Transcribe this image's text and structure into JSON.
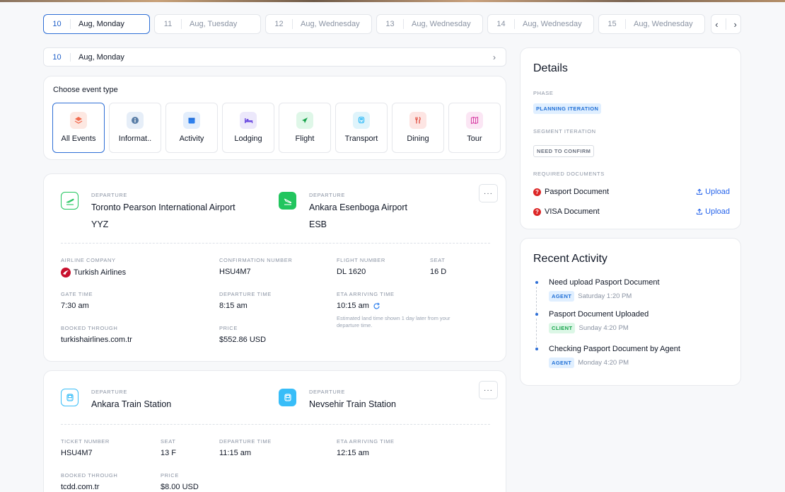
{
  "dates": [
    {
      "num": "10",
      "label": "Aug, Monday"
    },
    {
      "num": "11",
      "label": "Aug, Tuesday"
    },
    {
      "num": "12",
      "label": "Aug, Wednesday"
    },
    {
      "num": "13",
      "label": "Aug, Wednesday"
    },
    {
      "num": "14",
      "label": "Aug, Wednesday"
    },
    {
      "num": "15",
      "label": "Aug, Wednesday"
    }
  ],
  "nav": {
    "prev": "‹",
    "next": "›"
  },
  "selected_day": {
    "num": "10",
    "label": "Aug, Monday",
    "chevron": "›"
  },
  "event_type": {
    "title": "Choose event type",
    "types": [
      {
        "label": "All Events",
        "icon": "layers-icon"
      },
      {
        "label": "Informat..",
        "icon": "info-icon"
      },
      {
        "label": "Activity",
        "icon": "calendar-icon"
      },
      {
        "label": "Lodging",
        "icon": "bed-icon"
      },
      {
        "label": "Flight",
        "icon": "plane-icon"
      },
      {
        "label": "Transport",
        "icon": "train-icon"
      },
      {
        "label": "Dining",
        "icon": "fork-knife-icon"
      },
      {
        "label": "Tour",
        "icon": "map-icon"
      }
    ]
  },
  "flight": {
    "from": {
      "caption": "DEPARTURE",
      "name": "Toronto Pearson International Airport",
      "code": "YYZ"
    },
    "to": {
      "caption": "DEPARTURE",
      "name": "Ankara Esenboga Airport",
      "code": "ESB"
    },
    "more": "···",
    "airline": {
      "caption": "AIRLINE COMPANY",
      "value": "Turkish Airlines"
    },
    "confirmation": {
      "caption": "CONFIRMATION NUMBER",
      "value": "HSU4M7"
    },
    "flight_number": {
      "caption": "FLIGHT NUMBER",
      "value": "DL 1620"
    },
    "seat": {
      "caption": "SEAT",
      "value": "16 D"
    },
    "gate_time": {
      "caption": "GATE TIME",
      "value": "7:30 am"
    },
    "departure_time": {
      "caption": "DEPARTURE TIME",
      "value": "8:15 am"
    },
    "eta": {
      "caption": "ETA ARRIVING TIME",
      "value": "10:15 am",
      "note": "Estimated land time shown 1 day later from your departure time."
    },
    "booked": {
      "caption": "BOOKED THROUGH",
      "value": "turkishairlines.com.tr"
    },
    "price": {
      "caption": "PRICE",
      "value": "$552.86 USD"
    }
  },
  "train": {
    "from": {
      "caption": "DEPARTURE",
      "name": "Ankara Train Station"
    },
    "to": {
      "caption": "DEPARTURE",
      "name": "Nevsehir Train Station"
    },
    "more": "···",
    "ticket": {
      "caption": "TICKET NUMBER",
      "value": "HSU4M7"
    },
    "seat": {
      "caption": "SEAT",
      "value": "13 F"
    },
    "departure_time": {
      "caption": "DEPARTURE TIME",
      "value": "11:15 am"
    },
    "eta": {
      "caption": "ETA ARRIVING TIME",
      "value": "12:15 am"
    },
    "booked": {
      "caption": "BOOKED THROUGH",
      "value": "tcdd.com.tr"
    },
    "price": {
      "caption": "PRICE",
      "value": "$8.00 USD"
    }
  },
  "details": {
    "title": "Details",
    "phase_caption": "PHASE",
    "phase": "PLANNING ITERATION",
    "segment_caption": "SEGMENT ITERATION",
    "segment": "NEED TO CONFIRM",
    "docs_caption": "REQUIRED DOCUMENTS",
    "docs": [
      {
        "name": "Pasport Document",
        "action": "Upload"
      },
      {
        "name": "VISA Document",
        "action": "Upload"
      }
    ]
  },
  "recent": {
    "title": "Recent Activity",
    "items": [
      {
        "text": "Need upload Pasport Document",
        "role": "AGENT",
        "time": "Saturday 1:20 PM"
      },
      {
        "text": "Pasport Document Uploaded",
        "role": "CLIENT",
        "time": "Sunday 4:20 PM"
      },
      {
        "text": "Checking Pasport Document by Agent",
        "role": "AGENT",
        "time": "Monday 4:20 PM"
      }
    ]
  },
  "colors": {
    "accent": "#2f6fd6",
    "flight_green": "#22c55e",
    "train_blue": "#38bdf8",
    "error": "#dc2626"
  }
}
